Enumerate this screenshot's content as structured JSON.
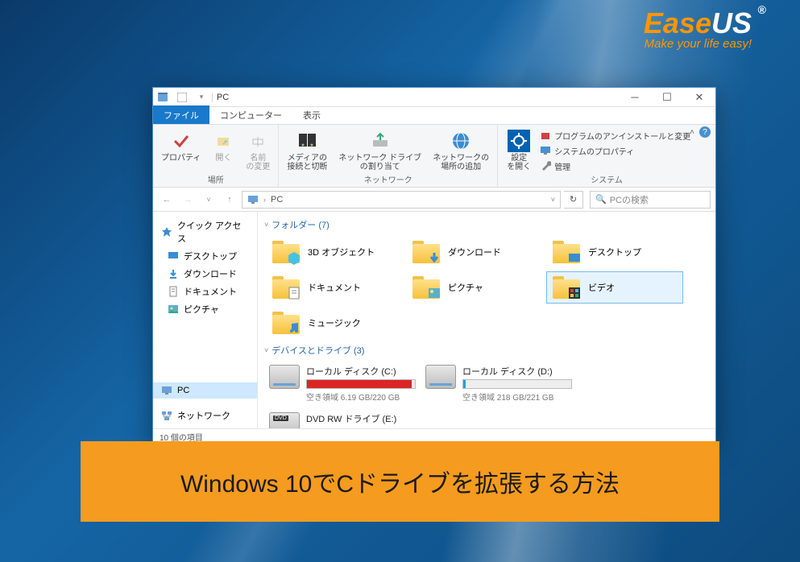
{
  "logo": {
    "ease": "Ease",
    "us": "US",
    "reg": "®",
    "tagline": "Make your life easy!"
  },
  "window": {
    "title": "PC",
    "tabs": {
      "file": "ファイル",
      "computer": "コンピューター",
      "view": "表示"
    },
    "ribbon": {
      "loc_group": "場所",
      "properties": "プロパティ",
      "open": "開く",
      "rename": "名前\nの変更",
      "net_group": "ネットワーク",
      "media": "メディアの\n接続と切断",
      "map_drive": "ネットワーク ドライブ\nの割り当て",
      "add_location": "ネットワークの\n場所の追加",
      "sys_group": "システム",
      "settings": "設定\nを開く",
      "uninstall": "プログラムのアンインストールと変更",
      "sys_props": "システムのプロパティ",
      "manage": "管理"
    },
    "addr": {
      "pc": "PC",
      "search_placeholder": "PCの検索"
    },
    "sidebar": {
      "quick": "クイック アクセス",
      "desktop": "デスクトップ",
      "downloads": "ダウンロード",
      "documents": "ドキュメント",
      "pictures": "ピクチャ",
      "pc": "PC",
      "network": "ネットワーク"
    },
    "content": {
      "folders_hdr": "フォルダー (7)",
      "devices_hdr": "デバイスとドライブ (3)",
      "folders": {
        "objects3d": "3D オブジェクト",
        "downloads": "ダウンロード",
        "desktop": "デスクトップ",
        "documents": "ドキュメント",
        "pictures": "ピクチャ",
        "videos": "ビデオ",
        "music": "ミュージック"
      },
      "drives": {
        "c": {
          "name": "ローカル ディスク (C:)",
          "free": "空き領域 6.19 GB/220 GB",
          "pct": 97
        },
        "d": {
          "name": "ローカル ディスク (D:)",
          "free": "空き領域 218 GB/221 GB",
          "pct": 2
        },
        "e": {
          "name": "DVD RW ドライブ (E:)"
        }
      }
    },
    "status": "10 個の項目"
  },
  "banner": "Windows 10でCドライブを拡張する方法"
}
